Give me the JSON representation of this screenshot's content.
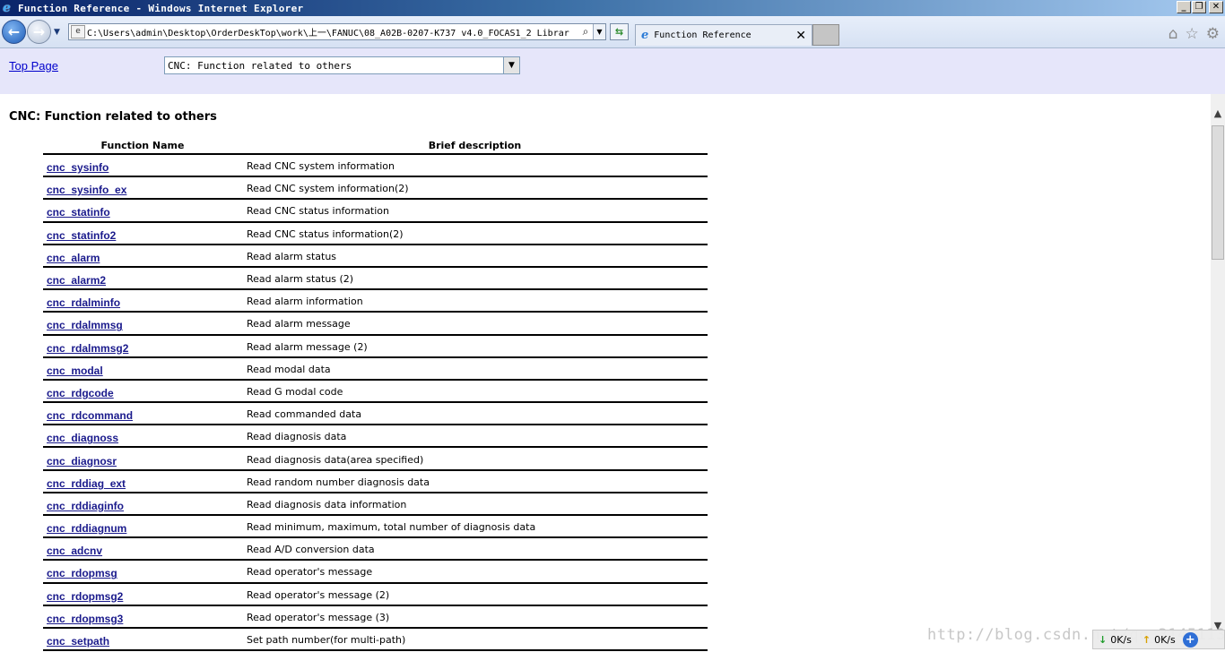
{
  "window": {
    "title": "Function Reference - Windows Internet Explorer",
    "minimize": "_",
    "restore": "❐",
    "close": "✕"
  },
  "browser": {
    "address": "C:\\Users\\admin\\Desktop\\OrderDeskTop\\work\\上一\\FANUC\\08_A02B-0207-K737 v4.0_FOCAS1_2 Librar",
    "tab_title": "Function Reference",
    "tab_close": "✕"
  },
  "header": {
    "top_link": "Top Page",
    "select_value": "CNC: Function related to others"
  },
  "main": {
    "heading": "CNC: Function related to others",
    "columns": [
      "Function Name",
      "Brief description"
    ],
    "rows": [
      {
        "name": "cnc_sysinfo",
        "desc": "Read CNC system information"
      },
      {
        "name": "cnc_sysinfo_ex",
        "desc": "Read CNC system information(2)"
      },
      {
        "name": "cnc_statinfo",
        "desc": "Read CNC status information"
      },
      {
        "name": "cnc_statinfo2",
        "desc": "Read CNC status information(2)"
      },
      {
        "name": "cnc_alarm",
        "desc": "Read alarm status"
      },
      {
        "name": "cnc_alarm2",
        "desc": "Read alarm status (2)"
      },
      {
        "name": "cnc_rdalminfo",
        "desc": "Read alarm information"
      },
      {
        "name": "cnc_rdalmmsg",
        "desc": "Read alarm message"
      },
      {
        "name": "cnc_rdalmmsg2",
        "desc": "Read alarm message (2)"
      },
      {
        "name": "cnc_modal",
        "desc": "Read modal data"
      },
      {
        "name": "cnc_rdgcode",
        "desc": "Read G modal code"
      },
      {
        "name": "cnc_rdcommand",
        "desc": "Read commanded data"
      },
      {
        "name": "cnc_diagnoss",
        "desc": "Read diagnosis data"
      },
      {
        "name": "cnc_diagnosr",
        "desc": "Read diagnosis data(area specified)"
      },
      {
        "name": "cnc_rddiag_ext",
        "desc": "Read random number diagnosis data"
      },
      {
        "name": "cnc_rddiaginfo",
        "desc": "Read diagnosis data information"
      },
      {
        "name": "cnc_rddiagnum",
        "desc": "Read minimum, maximum, total number of diagnosis data"
      },
      {
        "name": "cnc_adcnv",
        "desc": "Read A/D conversion data"
      },
      {
        "name": "cnc_rdopmsg",
        "desc": "Read operator's message"
      },
      {
        "name": "cnc_rdopmsg2",
        "desc": "Read operator's message (2)"
      },
      {
        "name": "cnc_rdopmsg3",
        "desc": "Read operator's message (3)"
      },
      {
        "name": "cnc_setpath",
        "desc": "Set path number(for multi-path)"
      }
    ]
  },
  "overlay": {
    "watermark": "http://blog.csdn.net/qq_3145113",
    "down_speed": "0K/s",
    "up_speed": "0K/s"
  }
}
